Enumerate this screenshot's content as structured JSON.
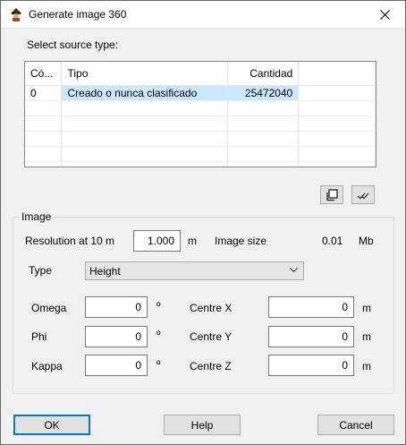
{
  "window": {
    "title": "Generate image 360"
  },
  "source": {
    "label": "Select source type:",
    "columns": [
      "Có...",
      "Tipo",
      "Cantidad"
    ],
    "rows": [
      {
        "code": "0",
        "type": "Creado o nunca clasificado",
        "count": "25472040"
      }
    ]
  },
  "image": {
    "group_label": "Image",
    "resolution_label": "Resolution at 10 m",
    "resolution_value": "1.000",
    "resolution_unit": "m",
    "size_label": "Image size",
    "size_value": "0.01",
    "size_unit": "Mb",
    "type_label": "Type",
    "type_value": "Height",
    "omega_label": "Omega",
    "omega_value": "0",
    "phi_label": "Phi",
    "phi_value": "0",
    "kappa_label": "Kappa",
    "kappa_value": "0",
    "degree_unit": "º",
    "centre_x_label": "Centre X",
    "centre_x_value": "0",
    "centre_y_label": "Centre Y",
    "centre_y_value": "0",
    "centre_z_label": "Centre Z",
    "centre_z_value": "0",
    "meter_unit": "m"
  },
  "buttons": {
    "ok": "OK",
    "help": "Help",
    "cancel": "Cancel"
  }
}
